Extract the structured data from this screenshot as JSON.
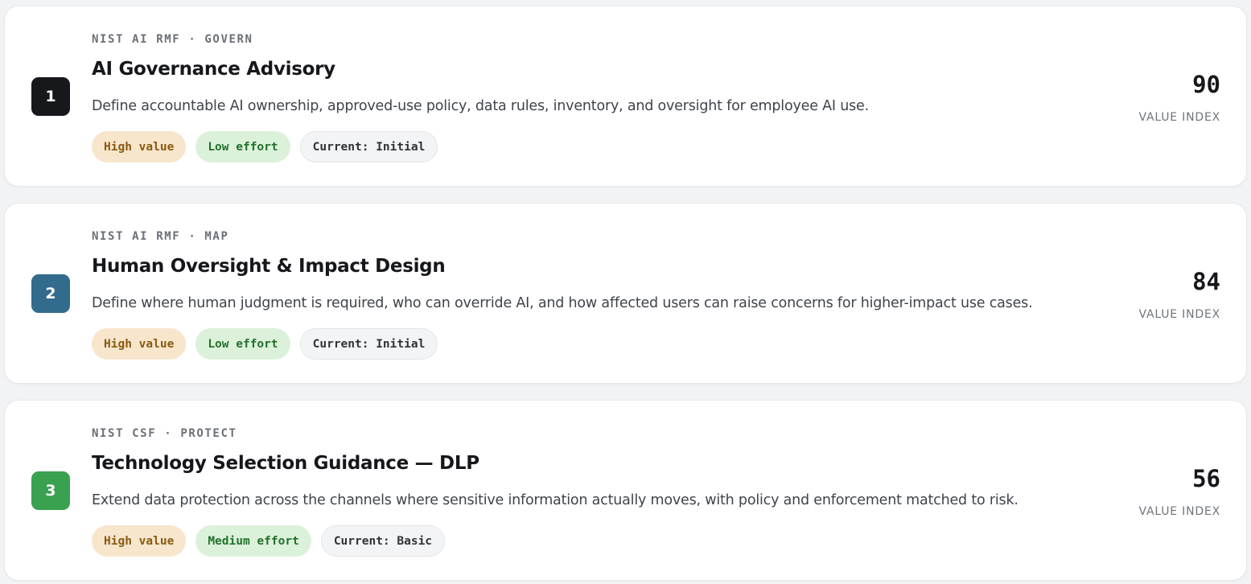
{
  "items": [
    {
      "rank": "1",
      "rank_color": "#16181c",
      "framework": "NIST AI RMF · GOVERN",
      "title": "AI Governance Advisory",
      "description": "Define accountable AI ownership, approved-use policy, data rules, inventory, and oversight for employee AI use.",
      "value_tag": "High value",
      "effort_tag": "Low effort",
      "current_tag": "Current: Initial",
      "score": "90",
      "score_label": "VALUE INDEX"
    },
    {
      "rank": "2",
      "rank_color": "#336b8c",
      "framework": "NIST AI RMF · MAP",
      "title": "Human Oversight & Impact Design",
      "description": "Define where human judgment is required, who can override AI, and how affected users can raise concerns for higher-impact use cases.",
      "value_tag": "High value",
      "effort_tag": "Low effort",
      "current_tag": "Current: Initial",
      "score": "84",
      "score_label": "VALUE INDEX"
    },
    {
      "rank": "3",
      "rank_color": "#3aa150",
      "framework": "NIST CSF · PROTECT",
      "title": "Technology Selection Guidance — DLP",
      "description": "Extend data protection across the channels where sensitive information actually moves, with policy and enforcement matched to risk.",
      "value_tag": "High value",
      "effort_tag": "Medium effort",
      "current_tag": "Current: Basic",
      "score": "56",
      "score_label": "VALUE INDEX"
    }
  ]
}
